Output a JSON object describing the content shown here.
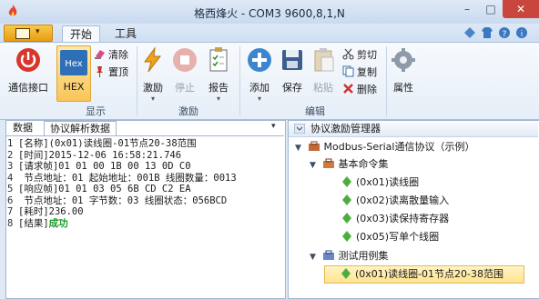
{
  "window": {
    "title": "格西烽火 - COM3  9600,8,1,N"
  },
  "tabs": [
    "开始",
    "工具"
  ],
  "ribbon": {
    "comm_port": "通信接口",
    "hex": "HEX",
    "hex_icon_text": "Hex",
    "clear": "清除",
    "pin_top": "置顶",
    "display_group": "显示",
    "excite": "激励",
    "stop": "停止",
    "report": "报告",
    "excite_group": "激励",
    "add": "添加",
    "save": "保存",
    "paste": "粘贴",
    "cut": "剪切",
    "copy": "复制",
    "delete": "删除",
    "edit_group": "编辑",
    "properties": "属性"
  },
  "left_panel": {
    "tabs": [
      "数据",
      "协议解析数据"
    ],
    "lines": [
      {
        "n": "1",
        "text": "[名称](0x01)读线圈-01节点20-38范围"
      },
      {
        "n": "2",
        "text": "[时间]2015-12-06 16:58:21.746"
      },
      {
        "n": "3",
        "text": "[请求帧]01 01 00 1B 00 13 0D C0"
      },
      {
        "n": "4",
        "text": " 节点地址：01  起始地址：001B  线圈数量：0013"
      },
      {
        "n": "5",
        "text": "[响应帧]01 01 03 05 6B CD C2 EA"
      },
      {
        "n": "6",
        "text": " 节点地址：01  字节数：03  线圈状态：056BCD"
      },
      {
        "n": "7",
        "text": "[耗时]236.00"
      }
    ],
    "result_prefix": "[结果]",
    "result_value": "成功",
    "result_n": "8"
  },
  "right_panel": {
    "title": "协议激励管理器",
    "tree": {
      "root": "Modbus-Serial通信协议（示例）",
      "basic": "基本命令集",
      "cmds": [
        "(0x01)读线圈",
        "(0x02)读离散量输入",
        "(0x03)读保持寄存器",
        "(0x05)写单个线圈"
      ],
      "tests": "测试用例集",
      "selected": "(0x01)读线圈-01节点20-38范围"
    }
  },
  "colors": {
    "accent": "#f8c65a",
    "success": "#1c9b2a"
  }
}
